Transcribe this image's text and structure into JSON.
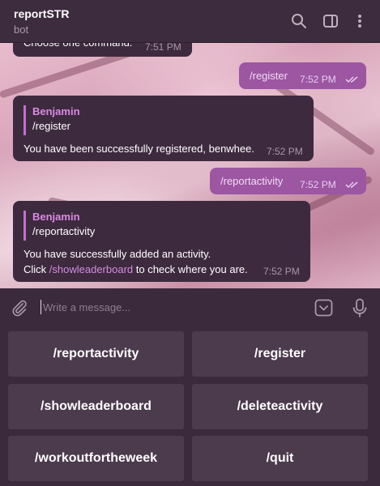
{
  "header": {
    "title": "reportSTR",
    "subtitle": "bot"
  },
  "messages": {
    "partial_text": "Choose one command.",
    "partial_time": "7:51 PM",
    "out1_text": "/register",
    "out1_time": "7:52 PM",
    "in1_quote_name": "Benjamin",
    "in1_quote_text": "/register",
    "in1_text": "You have been successfully registered, benwhee.",
    "in1_time": "7:52 PM",
    "out2_text": "/reportactivity",
    "out2_time": "7:52 PM",
    "in2_quote_name": "Benjamin",
    "in2_quote_text": "/reportactivity",
    "in2_line1": "You have successfully added an activity.",
    "in2_click": "Click ",
    "in2_link": "/showleaderboard",
    "in2_rest": " to check where you are.",
    "in2_time": "7:52 PM"
  },
  "composer": {
    "placeholder": "Write a message..."
  },
  "keyboard": {
    "buttons": [
      "/reportactivity",
      "/register",
      "/showleaderboard",
      "/deleteactivity",
      "/workoutfortheweek",
      "/quit"
    ]
  },
  "icons": {
    "search": "search-icon",
    "sidebar": "sidebar-toggle-icon",
    "menu": "more-vertical-icon",
    "attach": "paperclip-icon",
    "emoji": "bot-keyboard-icon",
    "mic": "microphone-icon",
    "read": "double-check-icon"
  }
}
